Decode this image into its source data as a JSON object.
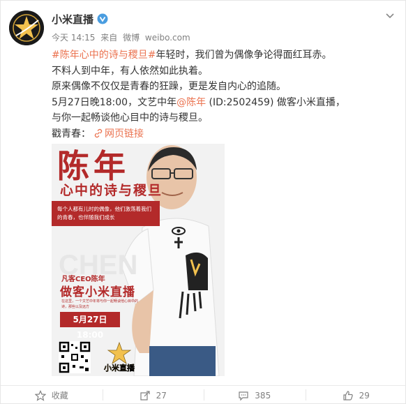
{
  "user": {
    "name": "小米直播",
    "verified_icon": "verified-v-icon",
    "avatar_icon": "star-logo-avatar"
  },
  "meta": {
    "time": "今天 14:15",
    "from_prefix": "来自",
    "source": "微博",
    "site": "weibo.com"
  },
  "post": {
    "line1_topic": "#陈年心中的诗与稷旦#",
    "line1_rest": "年轻时，我们曾为偶像争论得面红耳赤。",
    "line2": "不料人到中年，有人依然如此执着。",
    "line3": "原来偶像不仅仅是青春的狂躁，更是发自内心的追随。",
    "line4_pre": "5月27日晚18:00，文艺中年",
    "line4_mention": "@陈年",
    "line4_post": " (ID:2502459) 做客小米直播，",
    "line5": "与你一起畅谈他心目中的诗与稷旦。",
    "line6_label": "戳青春：",
    "line6_link": "网页链接"
  },
  "poster": {
    "title_big": "陈年",
    "title_sub": "心中的诗与稷旦",
    "banner": "每个人都有儿时的偶像，他们激荡着我们的青春，也伴随我们成长",
    "ghost": "CHEN",
    "ceo": "凡客CEO陈年",
    "zuoke": "做客小米直播",
    "small": "在这里，一个文艺中年将与你一起畅谈他心目中的诗，那些以及远方",
    "date": "5月27日 18:00",
    "logo_text": "小米直播"
  },
  "actions": {
    "favorite_label": "收藏",
    "repost_count": "27",
    "comment_count": "385",
    "like_count": "29"
  },
  "colors": {
    "link": "#eb7350",
    "poster_red": "#b32a2a",
    "meta_gray": "#808080"
  }
}
